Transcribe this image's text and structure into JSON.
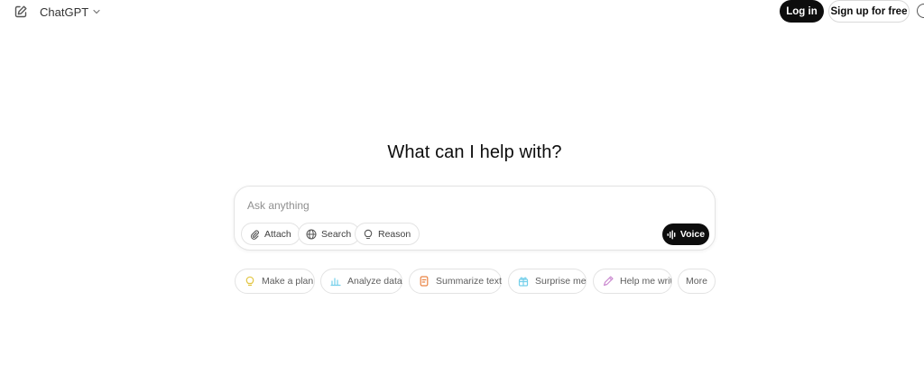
{
  "header": {
    "model_label": "ChatGPT",
    "login_label": "Log in",
    "signup_label": "Sign up for free"
  },
  "main": {
    "heading": "What can I help with?"
  },
  "composer": {
    "placeholder": "Ask anything",
    "tools": {
      "attach": "Attach",
      "search": "Search",
      "reason": "Reason"
    },
    "voice_label": "Voice"
  },
  "suggestions": [
    {
      "label": "Make a plan",
      "icon": "lightbulb-icon",
      "color": "#e2c541"
    },
    {
      "label": "Analyze data",
      "icon": "bar-chart-icon",
      "color": "#76d0eb"
    },
    {
      "label": "Summarize text",
      "icon": "document-icon",
      "color": "#ea8444"
    },
    {
      "label": "Surprise me",
      "icon": "gift-icon",
      "color": "#76d0eb"
    },
    {
      "label": "Help me write",
      "icon": "pen-icon",
      "color": "#cb8bd0"
    },
    {
      "label": "More",
      "icon": "",
      "color": ""
    }
  ],
  "colors": {
    "primary_button": "#0d0d0d",
    "border": "#e3e3e3",
    "placeholder": "#8f8f8f"
  }
}
